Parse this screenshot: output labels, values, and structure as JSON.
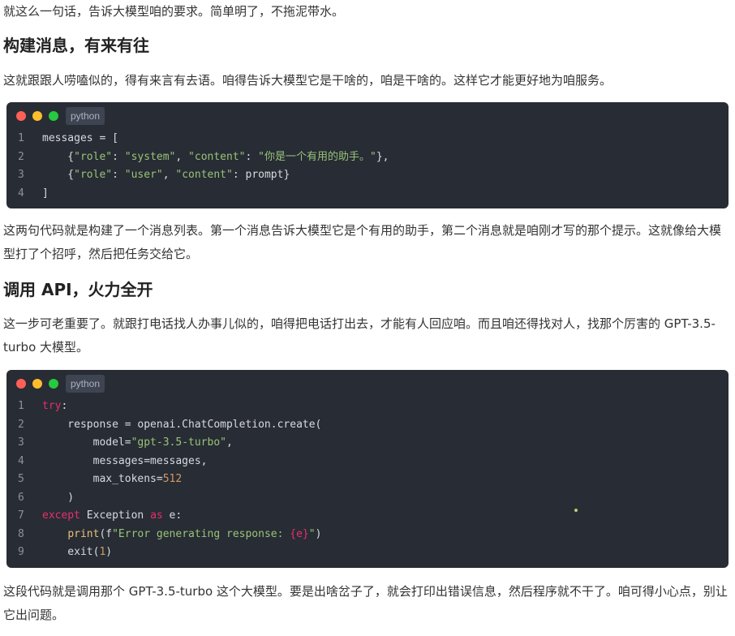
{
  "paragraphs": {
    "p0": "就这么一句话，告诉大模型咱的要求。简单明了，不拖泥带水。",
    "p1": "这就跟跟人唠嗑似的，得有来言有去语。咱得告诉大模型它是干啥的，咱是干啥的。这样它才能更好地为咱服务。",
    "p2": "这两句代码就是构建了一个消息列表。第一个消息告诉大模型它是个有用的助手，第二个消息就是咱刚才写的那个提示。这就像给大模型打了个招呼，然后把任务交给它。",
    "p3": "这一步可老重要了。就跟打电话找人办事儿似的，咱得把电话打出去，才能有人回应咱。而且咱还得找对人，找那个厉害的 GPT-3.5-turbo 大模型。",
    "p4": "这段代码就是调用那个 GPT-3.5-turbo 这个大模型。要是出啥岔子了，就会打印出错误信息，然后程序就不干了。咱可得小心点，别让它出问题。"
  },
  "headings": {
    "h1": "构建消息，有来有往",
    "h2": "调用 API，火力全开"
  },
  "code1": {
    "lang": "python",
    "lines": [
      {
        "n": "1",
        "tokens": [
          {
            "t": "messages = [",
            "c": "plain"
          }
        ]
      },
      {
        "n": "2",
        "tokens": [
          {
            "t": "    {",
            "c": "plain"
          },
          {
            "t": "\"role\"",
            "c": "str"
          },
          {
            "t": ": ",
            "c": "plain"
          },
          {
            "t": "\"system\"",
            "c": "str"
          },
          {
            "t": ", ",
            "c": "plain"
          },
          {
            "t": "\"content\"",
            "c": "str"
          },
          {
            "t": ": ",
            "c": "plain"
          },
          {
            "t": "\"你是一个有用的助手。\"",
            "c": "str"
          },
          {
            "t": "},",
            "c": "plain"
          }
        ]
      },
      {
        "n": "3",
        "tokens": [
          {
            "t": "    {",
            "c": "plain"
          },
          {
            "t": "\"role\"",
            "c": "str"
          },
          {
            "t": ": ",
            "c": "plain"
          },
          {
            "t": "\"user\"",
            "c": "str"
          },
          {
            "t": ", ",
            "c": "plain"
          },
          {
            "t": "\"content\"",
            "c": "str"
          },
          {
            "t": ": prompt}",
            "c": "plain"
          }
        ]
      },
      {
        "n": "4",
        "tokens": [
          {
            "t": "]",
            "c": "plain"
          }
        ]
      }
    ]
  },
  "code2": {
    "lang": "python",
    "lines": [
      {
        "n": "1",
        "tokens": [
          {
            "t": "try",
            "c": "kw"
          },
          {
            "t": ":",
            "c": "plain"
          }
        ]
      },
      {
        "n": "2",
        "tokens": [
          {
            "t": "    response = openai.ChatCompletion.create(",
            "c": "plain"
          }
        ]
      },
      {
        "n": "3",
        "tokens": [
          {
            "t": "        model=",
            "c": "plain"
          },
          {
            "t": "\"gpt-3.5-turbo\"",
            "c": "str"
          },
          {
            "t": ",",
            "c": "plain"
          }
        ]
      },
      {
        "n": "4",
        "tokens": [
          {
            "t": "        messages=messages,",
            "c": "plain"
          }
        ]
      },
      {
        "n": "5",
        "tokens": [
          {
            "t": "        max_tokens=",
            "c": "plain"
          },
          {
            "t": "512",
            "c": "num"
          }
        ]
      },
      {
        "n": "6",
        "tokens": [
          {
            "t": "    )",
            "c": "plain"
          }
        ]
      },
      {
        "n": "7",
        "tokens": [
          {
            "t": "except",
            "c": "kw"
          },
          {
            "t": " Exception ",
            "c": "plain"
          },
          {
            "t": "as",
            "c": "kw"
          },
          {
            "t": " e:",
            "c": "plain"
          }
        ]
      },
      {
        "n": "8",
        "tokens": [
          {
            "t": "    ",
            "c": "plain"
          },
          {
            "t": "print",
            "c": "fn"
          },
          {
            "t": "(f",
            "c": "plain"
          },
          {
            "t": "\"Error generating response: ",
            "c": "str"
          },
          {
            "t": "{e}",
            "c": "ph"
          },
          {
            "t": "\"",
            "c": "str"
          },
          {
            "t": ")",
            "c": "plain"
          }
        ]
      },
      {
        "n": "9",
        "tokens": [
          {
            "t": "    exit(",
            "c": "plain"
          },
          {
            "t": "1",
            "c": "num"
          },
          {
            "t": ")",
            "c": "plain"
          }
        ]
      }
    ]
  }
}
